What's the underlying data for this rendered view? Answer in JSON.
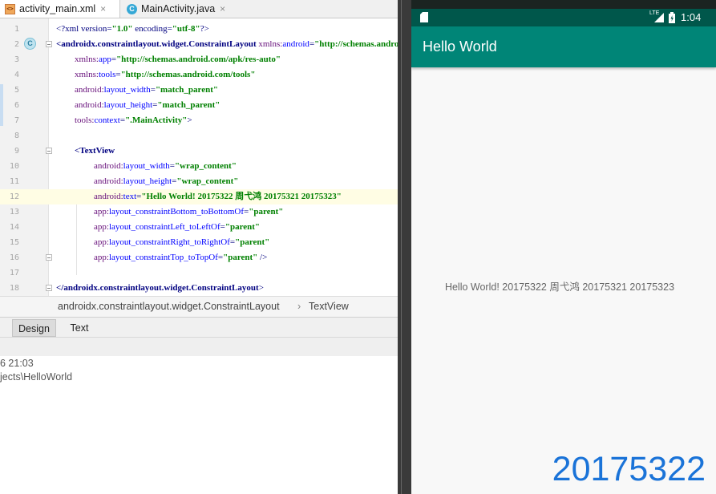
{
  "tabs": [
    {
      "label": "activity_main.xml",
      "close": "×",
      "icon_text": "<>"
    },
    {
      "label": "MainActivity.java",
      "close": "×",
      "icon_text": "C"
    }
  ],
  "editor": {
    "line_numbers": [
      "1",
      "2",
      "3",
      "4",
      "5",
      "6",
      "7",
      "8",
      "9",
      "10",
      "11",
      "12",
      "13",
      "14",
      "15",
      "16",
      "17",
      "18"
    ],
    "gutter_marker": "C",
    "lines": {
      "l1": [
        "<?xml version=",
        "\"1.0\"",
        " encoding=",
        "\"utf-8\"",
        "?>"
      ],
      "l2": [
        "<androidx.constraintlayout.widget.ConstraintLayout ",
        "xmlns:",
        "android",
        "=",
        "\"http://schemas.android.com/apk/res/android\""
      ],
      "l3": [
        "xmlns:",
        "app",
        "=",
        "\"http://schemas.android.com/apk/res-auto\""
      ],
      "l4": [
        "xmlns:",
        "tools",
        "=",
        "\"http://schemas.android.com/tools\""
      ],
      "l5": [
        "android:",
        "layout_width",
        "=",
        "\"match_parent\""
      ],
      "l6": [
        "android:",
        "layout_height",
        "=",
        "\"match_parent\""
      ],
      "l7": [
        "tools:",
        "context",
        "=",
        "\".MainActivity\"",
        ">"
      ],
      "l9": [
        "<TextView"
      ],
      "l10": [
        "android:",
        "layout_width",
        "=",
        "\"wrap_content\""
      ],
      "l11": [
        "android:",
        "layout_height",
        "=",
        "\"wrap_content\""
      ],
      "l12": [
        "android:",
        "text",
        "=",
        "\"Hello World! 20175322 周弋鸿 20175321 20175323\""
      ],
      "l13": [
        "app:",
        "layout_constraintBottom_toBottomOf",
        "=",
        "\"parent\""
      ],
      "l14": [
        "app:",
        "layout_constraintLeft_toLeftOf",
        "=",
        "\"parent\""
      ],
      "l15": [
        "app:",
        "layout_constraintRight_toRightOf",
        "=",
        "\"parent\""
      ],
      "l16": [
        "app:",
        "layout_constraintTop_toTopOf",
        "=",
        "\"parent\"",
        " />"
      ],
      "l18": [
        "</androidx.constraintlayout.widget.ConstraintLayout",
        ">"
      ]
    }
  },
  "breadcrumb": {
    "first": "androidx.constraintlayout.widget.ConstraintLayout",
    "separator": "›",
    "second": "TextView"
  },
  "bottom_tabs": {
    "design": "Design",
    "text": "Text"
  },
  "log": {
    "line1": "6 21:03",
    "line2": "jects\\HelloWorld"
  },
  "phone": {
    "status_time": "1:04",
    "lte": "LTE",
    "app_title": "Hello World",
    "hello_text": "Hello World! 20175322 周弋鸿 20175321 20175323",
    "accent_colors": {
      "app_bar": "#008577",
      "status_bar": "#00574b",
      "overlay": "#1a73d8"
    }
  },
  "overlay_number": "20175322"
}
